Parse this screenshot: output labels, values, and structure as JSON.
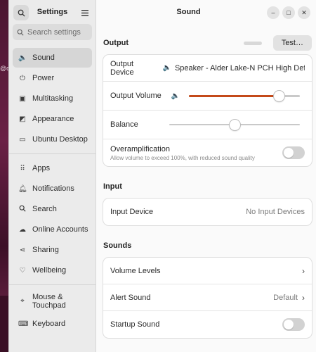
{
  "wallpaper": {
    "fragment": "@d"
  },
  "sidebar": {
    "title": "Settings",
    "search_placeholder": "Search settings",
    "items_group1": [
      {
        "label": "Sound",
        "icon": "speaker-icon"
      },
      {
        "label": "Power",
        "icon": "power-icon"
      },
      {
        "label": "Multitasking",
        "icon": "multitasking-icon"
      },
      {
        "label": "Appearance",
        "icon": "appearance-icon"
      },
      {
        "label": "Ubuntu Desktop",
        "icon": "desktop-icon"
      }
    ],
    "items_group2": [
      {
        "label": "Apps",
        "icon": "apps-icon"
      },
      {
        "label": "Notifications",
        "icon": "bell-icon"
      },
      {
        "label": "Search",
        "icon": "search-icon"
      },
      {
        "label": "Online Accounts",
        "icon": "cloud-icon"
      },
      {
        "label": "Sharing",
        "icon": "share-icon"
      },
      {
        "label": "Wellbeing",
        "icon": "wellbeing-icon"
      }
    ],
    "items_group3": [
      {
        "label_line1": "Mouse &",
        "label_line2": "Touchpad",
        "icon": "mouse-icon"
      },
      {
        "label": "Keyboard",
        "icon": "keyboard-icon"
      }
    ]
  },
  "main": {
    "title": "Sound",
    "output": {
      "section_title": "Output",
      "test_label": "Test…",
      "device_label": "Output Device",
      "device_value": "Speaker - Alder Lake-N PCH High Defini…",
      "volume_label": "Output Volume",
      "volume_level": 0.81,
      "balance_label": "Balance",
      "balance_level": 0.5,
      "overamp_label": "Overamplification",
      "overamp_sub": "Allow volume to exceed 100%, with reduced sound quality"
    },
    "input": {
      "section_title": "Input",
      "device_label": "Input Device",
      "device_value": "No Input Devices"
    },
    "sounds": {
      "section_title": "Sounds",
      "volume_levels": "Volume Levels",
      "alert_label": "Alert Sound",
      "alert_value": "Default",
      "startup_label": "Startup Sound"
    }
  },
  "colors": {
    "accent": "#c44a1a",
    "sidebar_bg": "#ebebeb"
  }
}
